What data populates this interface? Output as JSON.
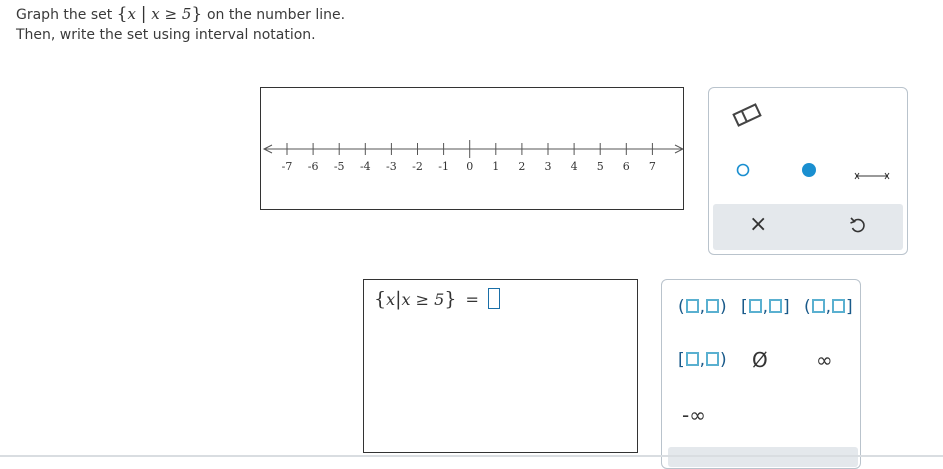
{
  "prompt": {
    "line1_before": "Graph the set",
    "set_var": "x",
    "set_condition": "x ≥ 5",
    "line1_after": "on the number line.",
    "line2": "Then, write the set using interval notation."
  },
  "number_line": {
    "min": -7,
    "max": 7,
    "tick_labels": [
      "-7",
      "-6",
      "-5",
      "-4",
      "-3",
      "-2",
      "-1",
      "0",
      "1",
      "2",
      "3",
      "4",
      "5",
      "6",
      "7"
    ]
  },
  "graph_tools": {
    "eraser": "eraser-icon",
    "open_point": "open-circle-icon",
    "closed_point": "closed-circle-icon",
    "segment": "segment-icon",
    "clear": "×",
    "undo": "undo-icon"
  },
  "answer": {
    "lhs_var": "x",
    "lhs_condition": "x ≥ 5",
    "equals": "=",
    "value": ""
  },
  "interval_keys": {
    "open_open": [
      "(",
      ",",
      ")"
    ],
    "closed_closed": [
      "[",
      ",",
      "]"
    ],
    "open_closed": [
      "(",
      ",",
      "]"
    ],
    "closed_open": [
      "[",
      ",",
      ")"
    ],
    "empty_set": "Ø",
    "infinity": "∞",
    "neg_infinity": "-∞"
  },
  "colors": {
    "accent": "#1a8fd0",
    "key_text": "#1a5a8a",
    "key_box": "#5ab0d0",
    "palette_border": "#b9c3cc"
  }
}
